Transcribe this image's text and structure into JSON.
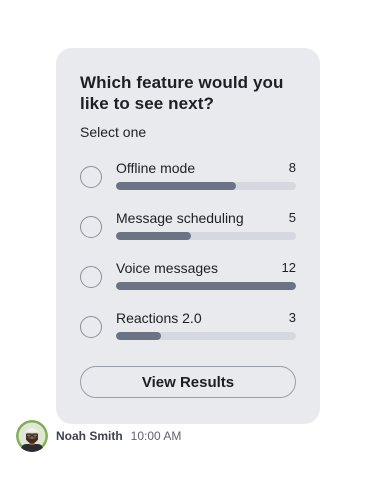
{
  "poll": {
    "question": "Which feature would you like to see next?",
    "instruction": "Select one",
    "options": [
      {
        "label": "Offline mode",
        "votes": "8",
        "share": 0.667
      },
      {
        "label": "Message scheduling",
        "votes": "5",
        "share": 0.417
      },
      {
        "label": "Voice messages",
        "votes": "12",
        "share": 1.0
      },
      {
        "label": "Reactions 2.0",
        "votes": "3",
        "share": 0.25
      }
    ],
    "results_button_label": "View Results"
  },
  "message_meta": {
    "sender_name": "Noah Smith",
    "timestamp": "10:00 AM",
    "avatar_icon": "user-avatar-photo"
  },
  "colors": {
    "card_background": "#e8eaed",
    "bar_fill": "#6b7385",
    "bar_track": "#d5d8de",
    "text": "#1d1f24"
  }
}
